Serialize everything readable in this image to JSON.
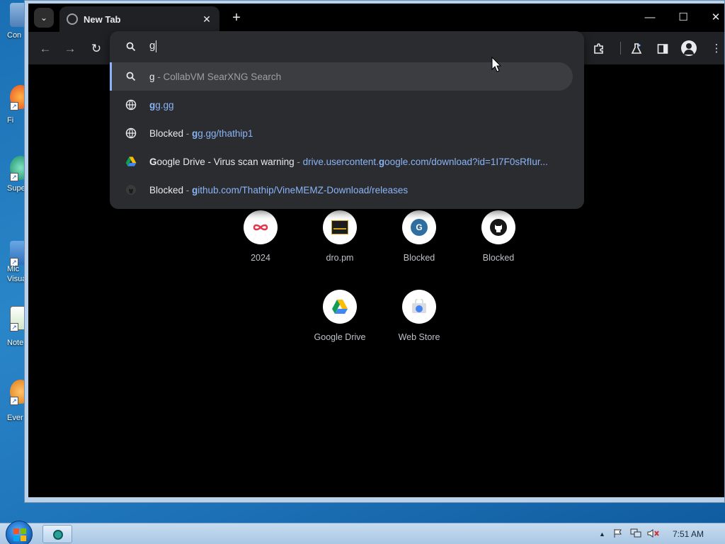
{
  "desktop": {
    "icons": [
      {
        "label": "Con"
      },
      {
        "label": "Fi"
      },
      {
        "label": "Supe"
      },
      {
        "label": "Mic"
      },
      {
        "label": "Visua"
      },
      {
        "label": "Note"
      },
      {
        "label": "Ever"
      }
    ]
  },
  "browser": {
    "tab": {
      "title": "New Tab",
      "close": "✕"
    },
    "new_tab": "+",
    "window_controls": {
      "minimize": "—",
      "maximize": "☐",
      "close": "✕"
    },
    "toolbar": {
      "back": "←",
      "forward": "→",
      "reload": "↻"
    },
    "omnibox": {
      "query": "g",
      "suggestions": [
        {
          "icon": "search-icon",
          "title": "g",
          "separator": " - ",
          "detail": "CollabVM SearXNG Search",
          "selected": true
        },
        {
          "icon": "globe-icon",
          "bold": "g",
          "url": "g.gg"
        },
        {
          "icon": "globe-icon",
          "title": "Blocked",
          "separator": " - ",
          "bold": "g",
          "url": "g.gg/thathip1"
        },
        {
          "icon": "google-drive-icon",
          "bold": "G",
          "title": "oogle Drive - Virus scan warning",
          "separator": " - ",
          "url_pre": "drive.usercontent.",
          "url_bold": "g",
          "url": "oogle.com/download?id=1I7F0sRfIur..."
        },
        {
          "icon": "github-icon",
          "title": "Blocked",
          "separator": " - ",
          "bold": "g",
          "url": "ithub.com/Thathip/VineMEMZ-Download/releases"
        }
      ]
    },
    "shortcuts": [
      {
        "label": "2024",
        "icon": "collab-icon"
      },
      {
        "label": "dro.pm",
        "icon": "dropm-icon"
      },
      {
        "label": "Blocked",
        "icon": "g-letter-icon",
        "letter": "G"
      },
      {
        "label": "Blocked",
        "icon": "github-icon"
      },
      {
        "label": "Google Drive",
        "icon": "google-drive-icon"
      },
      {
        "label": "Web Store",
        "icon": "web-store-icon"
      }
    ]
  },
  "taskbar": {
    "clock": "7:51 AM",
    "tray_arrow": "▲"
  },
  "colors": {
    "accent": "#8ab4f8",
    "omnibox_bg": "#2b2c2f",
    "page_bg": "#000000",
    "github_bg": "#ffffff",
    "g_letter_bg": "#2f6f9f"
  }
}
